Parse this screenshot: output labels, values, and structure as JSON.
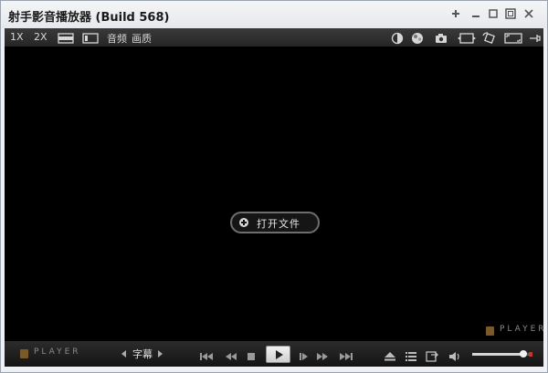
{
  "window": {
    "title": "射手影音播放器 (Build 568)",
    "controls": [
      "pin-icon",
      "minimize-icon",
      "restore-icon",
      "fullscreen-icon",
      "close-icon"
    ]
  },
  "toolbar": {
    "size_1x": "1X",
    "size_2x": "2X",
    "audio": "音频",
    "picture": "画质",
    "icons": [
      "wide-screen-icon",
      "normal-screen-icon",
      "brightness-icon",
      "color-icon",
      "snapshot-icon",
      "fit-window-icon",
      "rotate-icon",
      "screen-icon",
      "pin-top-icon"
    ]
  },
  "video": {
    "open_file": "打开文件",
    "logo_text": "PLAYER"
  },
  "controls": {
    "logo_text": "PLAYER",
    "subtitle": "字幕",
    "buttons": [
      "skip-back-icon",
      "rewind-icon",
      "stop-icon",
      "play-button",
      "step-forward-icon",
      "fast-forward-icon",
      "skip-forward-icon",
      "eject-icon",
      "playlist-icon",
      "settings-icon",
      "volume-icon"
    ],
    "volume_level": 0.9
  },
  "colors": {
    "video_bg": "#000000",
    "toolbar_bg": "#2f2f2f",
    "accent": "#c0392b"
  }
}
